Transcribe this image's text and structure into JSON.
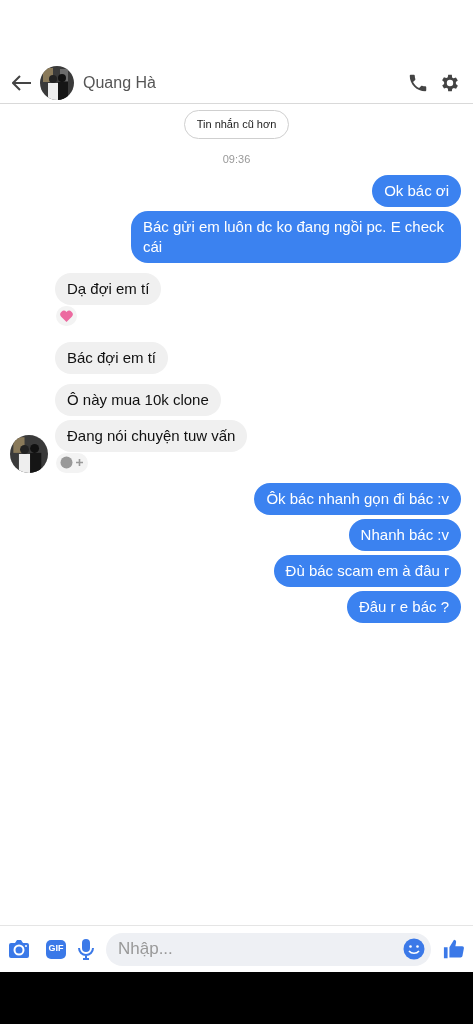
{
  "header": {
    "contact_name": "Quang Hà"
  },
  "older_button": "Tin nhắn cũ hơn",
  "timestamp": "09:36",
  "messages": [
    {
      "kind": "sent",
      "text": "Ok bác ơi"
    },
    {
      "kind": "sent",
      "text": "Bác gửi em luôn dc ko đang ngồi pc. E check cái"
    },
    {
      "kind": "received",
      "text": "Dạ đợi em tí",
      "reaction": {
        "kind": "heart"
      }
    },
    {
      "kind": "received",
      "text": "Bác đợi em tí"
    },
    {
      "kind": "received",
      "text": "Ô này mua 10k clone"
    },
    {
      "kind": "received",
      "text": "Đang nói chuyện tuw vấn",
      "reaction": {
        "kind": "add"
      },
      "avatar": true
    },
    {
      "kind": "sent",
      "text": "Ôk bác nhanh gọn đi bác :v"
    },
    {
      "kind": "sent",
      "text": "Nhanh bác :v"
    },
    {
      "kind": "sent",
      "text": "Đù bác scam em à đâu r"
    },
    {
      "kind": "sent",
      "text": "Đâu r e bác ?"
    }
  ],
  "composer": {
    "gif_label": "GIF",
    "placeholder": "Nhập..."
  }
}
